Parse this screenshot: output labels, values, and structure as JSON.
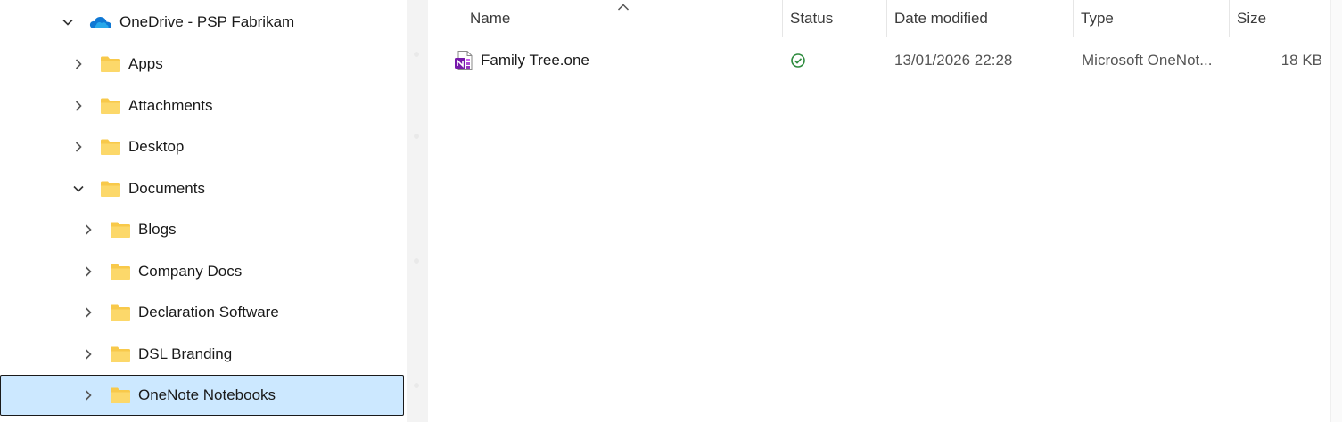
{
  "nav": {
    "items": [
      {
        "label": "OneDrive - PSP Fabrikam",
        "icon": "onedrive-cloud-icon",
        "expanded": true
      },
      {
        "label": "Apps",
        "icon": "folder-icon",
        "expanded": false
      },
      {
        "label": "Attachments",
        "icon": "folder-icon",
        "expanded": false
      },
      {
        "label": "Desktop",
        "icon": "folder-icon",
        "expanded": false
      },
      {
        "label": "Documents",
        "icon": "folder-icon",
        "expanded": true
      },
      {
        "label": "Blogs",
        "icon": "folder-icon",
        "expanded": false
      },
      {
        "label": "Company Docs",
        "icon": "folder-icon",
        "expanded": false
      },
      {
        "label": "Declaration Software",
        "icon": "folder-icon",
        "expanded": false
      },
      {
        "label": "DSL Branding",
        "icon": "folder-icon",
        "expanded": false
      },
      {
        "label": "OneNote Notebooks",
        "icon": "folder-icon",
        "expanded": false,
        "selected": true
      }
    ]
  },
  "columns": {
    "name": "Name",
    "status": "Status",
    "date_modified": "Date modified",
    "type": "Type",
    "size": "Size",
    "sort_icon": "sort-ascending-icon"
  },
  "files": [
    {
      "name": "Family Tree.one",
      "icon": "onenote-file-icon",
      "status_icon": "synced-check-icon",
      "date_modified": "13/01/2026 22:28",
      "type": "Microsoft OneNot...",
      "size": "18 KB"
    }
  ],
  "colors": {
    "selection": "#cce8ff",
    "folder": "#f8c94a",
    "onedrive": "#0f78d4",
    "status_ok": "#2e8b3e",
    "onenote": "#7719aa"
  }
}
